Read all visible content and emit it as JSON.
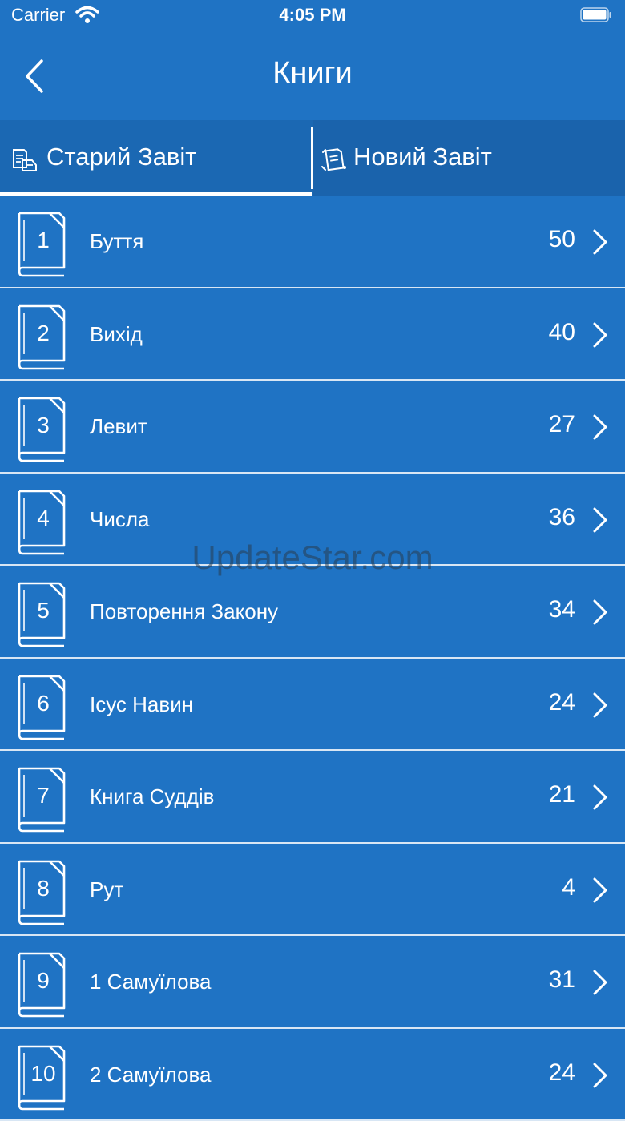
{
  "status_bar": {
    "carrier": "Carrier",
    "time": "4:05 PM"
  },
  "header": {
    "title": "Книги",
    "back_icon": "chevron-left-icon"
  },
  "tabs": [
    {
      "label": "Старий Завіт",
      "icon": "old-testament-icon",
      "selected": true
    },
    {
      "label": "Новий Завіт",
      "icon": "new-testament-icon",
      "selected": false
    }
  ],
  "books": [
    {
      "number": "1",
      "name": "Буття",
      "chapters": "50"
    },
    {
      "number": "2",
      "name": "Вихід",
      "chapters": "40"
    },
    {
      "number": "3",
      "name": "Левит",
      "chapters": "27"
    },
    {
      "number": "4",
      "name": "Числа",
      "chapters": "36"
    },
    {
      "number": "5",
      "name": "Повторення Закону",
      "chapters": "34"
    },
    {
      "number": "6",
      "name": "Ісус Навин",
      "chapters": "24"
    },
    {
      "number": "7",
      "name": "Книга Суддів",
      "chapters": "21"
    },
    {
      "number": "8",
      "name": "Рут",
      "chapters": "4"
    },
    {
      "number": "9",
      "name": "1 Самуїлова",
      "chapters": "31"
    },
    {
      "number": "10",
      "name": "2 Самуїлова",
      "chapters": "24"
    }
  ],
  "watermark": "UpdateStar.com",
  "colors": {
    "background": "#1f73c4",
    "tab_bar": "#1b68b3",
    "foreground": "#ffffff"
  }
}
